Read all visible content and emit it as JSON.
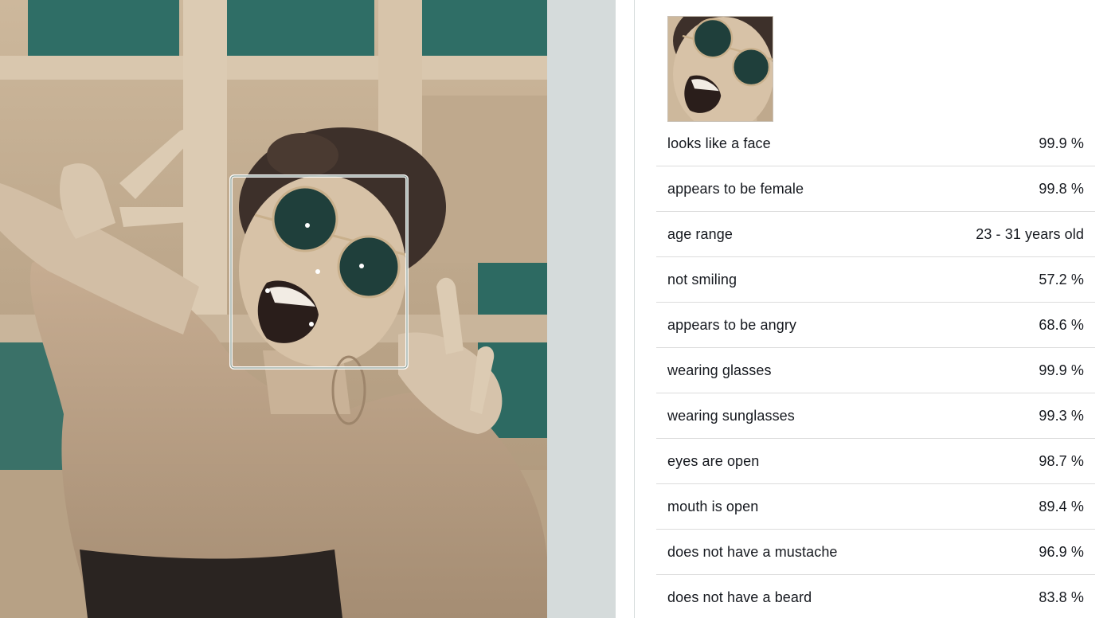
{
  "results": {
    "attributes": [
      {
        "label": "looks like a face",
        "value": "99.9 %"
      },
      {
        "label": "appears to be female",
        "value": "99.8 %"
      },
      {
        "label": "age range",
        "value": "23 - 31 years old"
      },
      {
        "label": "not smiling",
        "value": "57.2 %"
      },
      {
        "label": "appears to be angry",
        "value": "68.6 %"
      },
      {
        "label": "wearing glasses",
        "value": "99.9 %"
      },
      {
        "label": "wearing sunglasses",
        "value": "99.3 %"
      },
      {
        "label": "eyes are open",
        "value": "98.7 %"
      },
      {
        "label": "mouth is open",
        "value": "89.4 %"
      },
      {
        "label": "does not have a mustache",
        "value": "96.9 %"
      },
      {
        "label": "does not have a beard",
        "value": "83.8 %"
      }
    ]
  },
  "colors": {
    "bounding_box": "#e8f4f2",
    "landmark": "#ffffff",
    "gutter": "#d5dbdb",
    "divider": "#dcdcdc"
  }
}
